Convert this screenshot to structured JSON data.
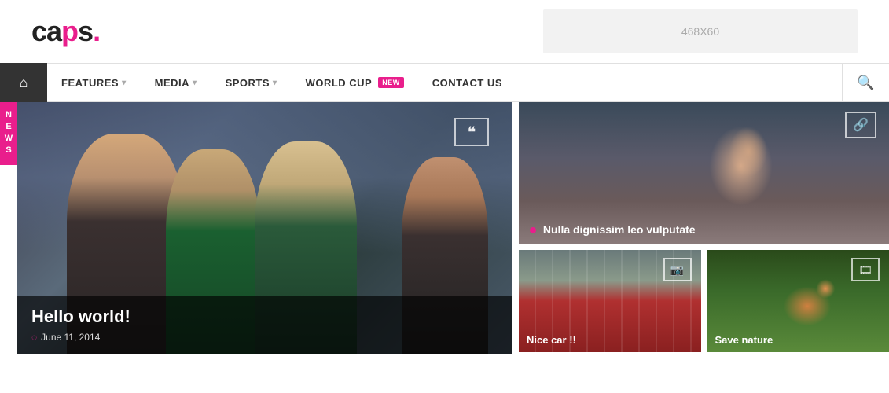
{
  "header": {
    "logo": "caps.",
    "ad_text": "468X60"
  },
  "nav": {
    "home_icon": "🏠",
    "items": [
      {
        "label": "FEATURES",
        "has_dropdown": true
      },
      {
        "label": "MEDIA",
        "has_dropdown": true
      },
      {
        "label": "SPORTS",
        "has_dropdown": true
      },
      {
        "label": "WORLD CUP",
        "has_dropdown": false,
        "badge": "NEW"
      },
      {
        "label": "CONTACT US",
        "has_dropdown": false
      }
    ],
    "search_icon": "🔍"
  },
  "sidebar_tag": "NEWS",
  "main_image": {
    "quote_icon": "❝",
    "caption": {
      "title": "Hello world!",
      "date": "June 11, 2014",
      "clock_icon": "⏰"
    }
  },
  "right_panel": {
    "top": {
      "link_icon": "🔗",
      "caption": "Nulla dignissim leo vulputate"
    },
    "bottom": [
      {
        "icon": "📷",
        "caption": "Nice car !!"
      },
      {
        "icon": "🎞",
        "caption": "Save nature"
      }
    ]
  }
}
